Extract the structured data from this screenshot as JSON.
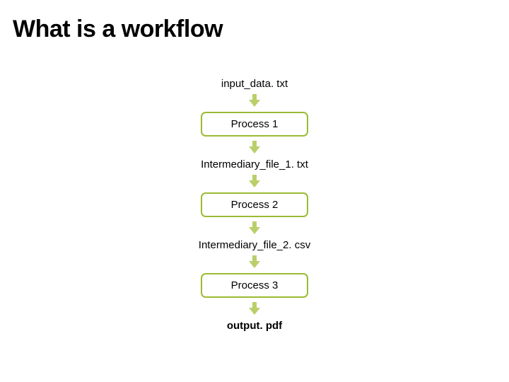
{
  "title": "What is a workflow",
  "colors": {
    "accent": "#9bbb32"
  },
  "flow": {
    "input": "input_data. txt",
    "p1": "Process 1",
    "f1": "Intermediary_file_1. txt",
    "p2": "Process 2",
    "f2": "Intermediary_file_2. csv",
    "p3": "Process 3",
    "output": "output. pdf"
  }
}
